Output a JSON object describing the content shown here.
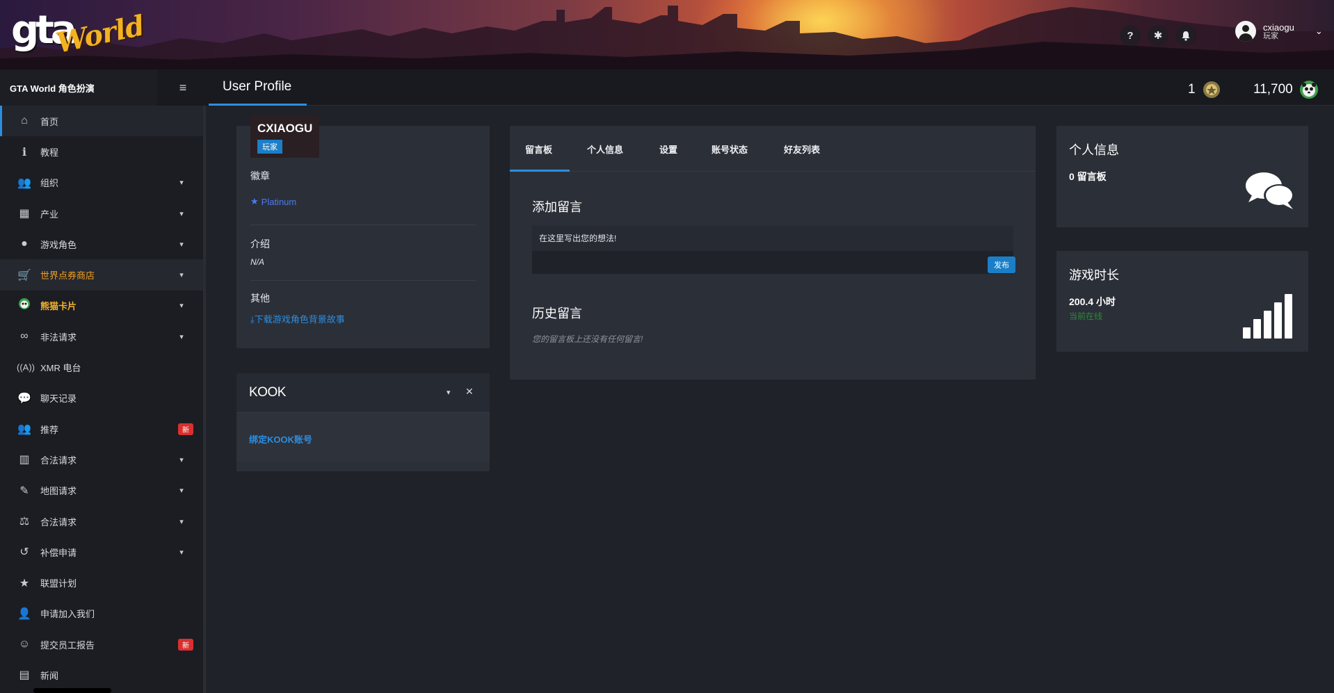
{
  "header": {
    "logo_text_gta": "gta",
    "logo_text_world": "World",
    "icons": [
      "question-icon",
      "gear-icon",
      "bell-icon"
    ],
    "icon_glyphs": [
      "?",
      "✱",
      "🔔"
    ],
    "user": {
      "name": "cxiaogu",
      "role": "玩家"
    }
  },
  "subheader": {
    "brand": "GTA World 角色扮演",
    "page_title": "User Profile",
    "badge_count": "1",
    "coins": "11,700"
  },
  "sidebar": {
    "items": [
      {
        "label": "首页",
        "icon": "home-icon"
      },
      {
        "label": "教程",
        "icon": "info-icon"
      },
      {
        "label": "组织",
        "icon": "users-icon"
      },
      {
        "label": "产业",
        "icon": "briefcase-icon"
      },
      {
        "label": "游戏角色",
        "icon": "user-icon"
      },
      {
        "label": "世界点券商店",
        "icon": "cart-icon"
      },
      {
        "label": "熊猫卡片",
        "icon": "panda-icon"
      },
      {
        "label": "非法请求",
        "icon": "mask-icon"
      },
      {
        "label": "XMR 电台",
        "icon": "radio-icon"
      },
      {
        "label": "聊天记录",
        "icon": "chat-icon"
      },
      {
        "label": "推荐",
        "icon": "user-group-icon",
        "badge": "新"
      },
      {
        "label": "合法请求",
        "icon": "building-icon"
      },
      {
        "label": "地图请求",
        "icon": "brush-icon"
      },
      {
        "label": "合法请求",
        "icon": "scale-icon"
      },
      {
        "label": "补偿申请",
        "icon": "undo-icon"
      },
      {
        "label": "联盟计划",
        "icon": "star-icon"
      },
      {
        "label": "申请加入我们",
        "icon": "user-tie-icon"
      },
      {
        "label": "提交员工报告",
        "icon": "smile-icon",
        "badge": "新"
      },
      {
        "label": "新闻",
        "icon": "newspaper-icon"
      }
    ]
  },
  "profile": {
    "name": "CXIAOGU",
    "role": "玩家",
    "badges_title": "徽章",
    "badge": "Platinum",
    "intro_title": "介绍",
    "intro": "N/A",
    "other_title": "其他",
    "download_link": "下载游戏角色背景故事"
  },
  "kook": {
    "title": "KOOK",
    "link": "绑定KOOK账号"
  },
  "main": {
    "tabs": [
      "留言板",
      "个人信息",
      "设置",
      "账号状态",
      "好友列表"
    ],
    "add_title": "添加留言",
    "input_placeholder": "在这里写出您的想法!",
    "post_button": "发布",
    "history_title": "历史留言",
    "empty": "您的留言板上还没有任何留言!"
  },
  "info_card": {
    "title": "个人信息",
    "value": "0 留言板"
  },
  "playtime_card": {
    "title": "游戏时长",
    "value": "200.4 小时",
    "status": "当前在线"
  },
  "colors": {
    "accent": "#2d8ee0",
    "background": "#1f2229",
    "card": "#2b2f38",
    "badge_new": "#d9302f",
    "online": "#2c8a3a"
  }
}
